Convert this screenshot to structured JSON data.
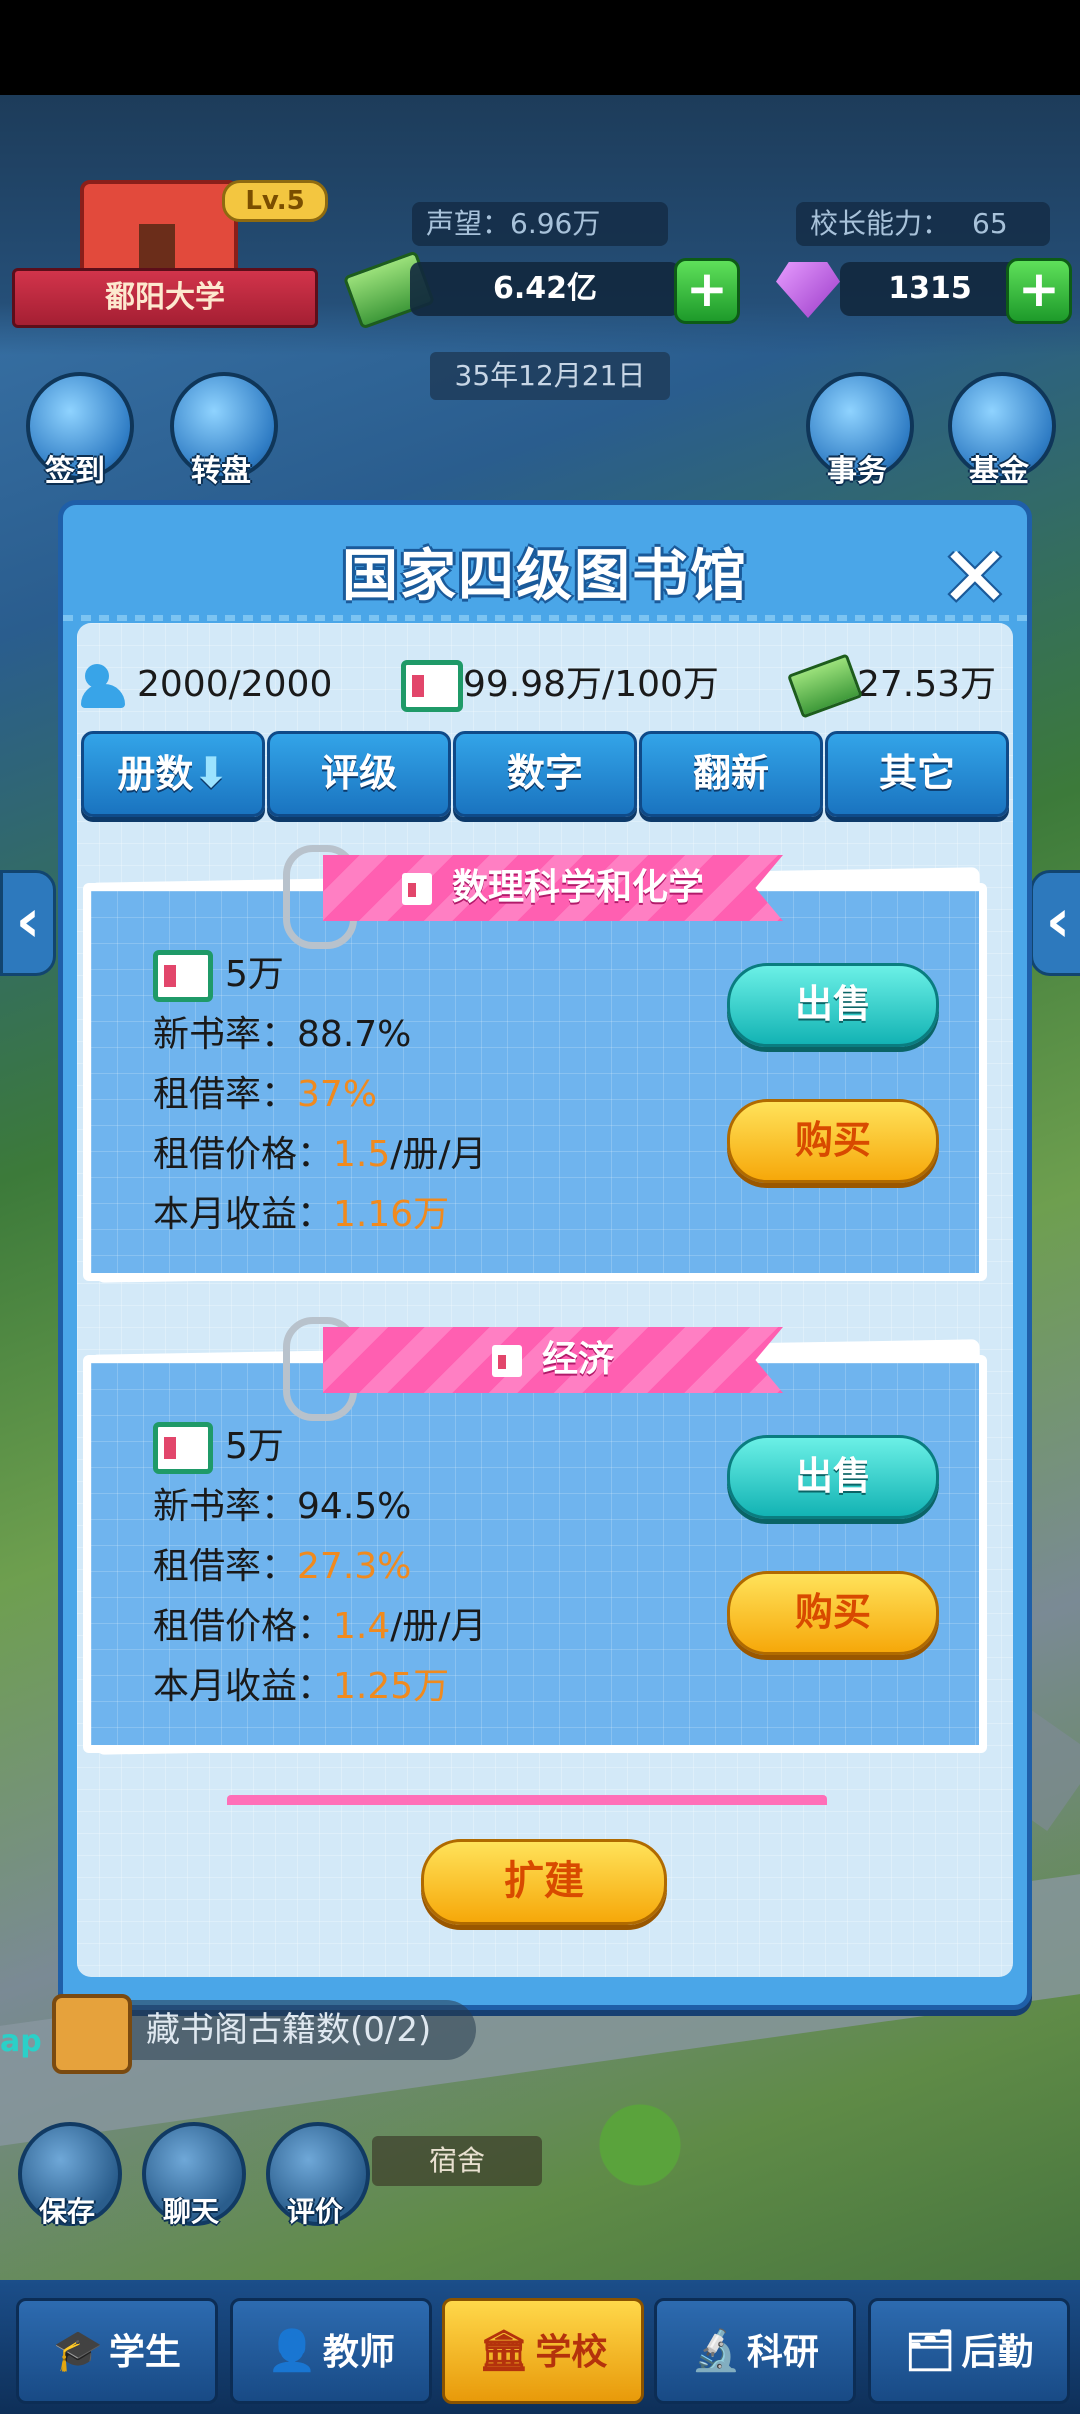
{
  "hud": {
    "school_name": "鄱阳大学",
    "level": "Lv.5",
    "reputation_label": "声望：",
    "reputation_value": "6.96万",
    "principal_label": "校长能力：",
    "principal_value": "65",
    "money": "6.42亿",
    "gems": "1315",
    "date": "35年12月21日",
    "left_buttons": [
      {
        "label": "签到"
      },
      {
        "label": "转盘"
      }
    ],
    "right_buttons": [
      {
        "label": "事务"
      },
      {
        "label": "基金"
      }
    ]
  },
  "modal": {
    "title": "国家四级图书馆",
    "close": "✕",
    "stats": {
      "students": "2000/2000",
      "books": "99.98万/100万",
      "money": "27.53万"
    },
    "tabs": [
      {
        "label": "册数",
        "arrow": "⬇"
      },
      {
        "label": "评级"
      },
      {
        "label": "数字"
      },
      {
        "label": "翻新"
      },
      {
        "label": "其它"
      }
    ],
    "cards": [
      {
        "category": "数理科学和化学",
        "count": "5万",
        "new_rate_label": "新书率：",
        "new_rate": "88.7%",
        "rent_rate_label": "租借率：",
        "rent_rate": "37%",
        "price_label": "租借价格：",
        "price_value": "1.5",
        "price_unit": "/册/月",
        "income_label": "本月收益：",
        "income": "1.16万",
        "sell": "出售",
        "buy": "购买"
      },
      {
        "category": "经济",
        "count": "5万",
        "new_rate_label": "新书率：",
        "new_rate": "94.5%",
        "rent_rate_label": "租借率：",
        "rent_rate": "27.3%",
        "price_label": "租借价格：",
        "price_value": "1.4",
        "price_unit": "/册/月",
        "income_label": "本月收益：",
        "income": "1.25万",
        "sell": "出售",
        "buy": "购买"
      }
    ],
    "expand": "扩建"
  },
  "below": {
    "ancient_books": "藏书阁古籍数(0/2)",
    "dorm": "宿舍",
    "app_edge": "ap",
    "small_buttons": [
      {
        "label": "保存"
      },
      {
        "label": "聊天"
      },
      {
        "label": "评价"
      }
    ]
  },
  "nav": [
    {
      "label": "学生",
      "icon": "graduation-cap-icon"
    },
    {
      "label": "教师",
      "icon": "teacher-icon"
    },
    {
      "label": "学校",
      "icon": "school-icon"
    },
    {
      "label": "科研",
      "icon": "microscope-icon"
    },
    {
      "label": "后勤",
      "icon": "logistics-icon"
    }
  ],
  "nav_active": "学校"
}
